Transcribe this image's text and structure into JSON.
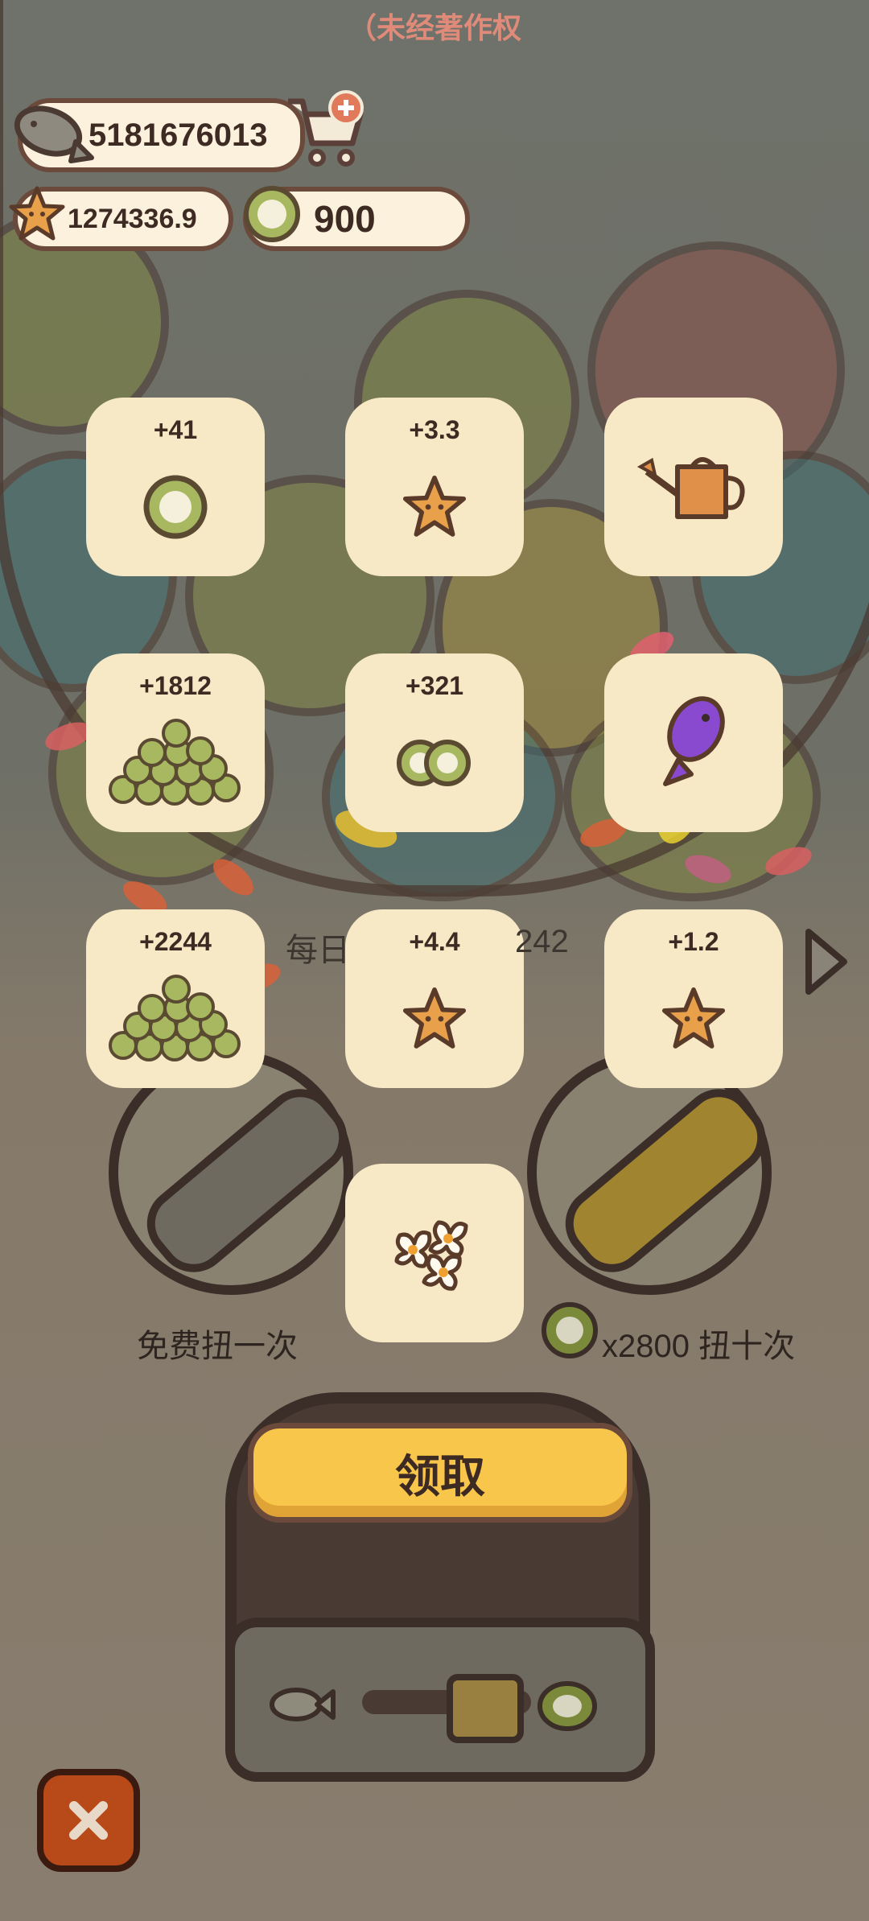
{
  "notice": "（未经著作权",
  "currency": {
    "fish": "5181676013",
    "stars": "1274336.9",
    "coins": "900"
  },
  "rewards": [
    {
      "amount": "+41",
      "icon": "coin-icon"
    },
    {
      "amount": "+3.3",
      "icon": "star-icon"
    },
    {
      "amount": "",
      "icon": "watering-can-icon"
    },
    {
      "amount": "+1812",
      "icon": "coin-pile-icon"
    },
    {
      "amount": "+321",
      "icon": "two-coins-icon"
    },
    {
      "amount": "",
      "icon": "purple-fish-icon"
    },
    {
      "amount": "+2244",
      "icon": "coin-pile-icon"
    },
    {
      "amount": "+4.4",
      "icon": "star-icon"
    },
    {
      "amount": "+1.2",
      "icon": "star-icon"
    },
    {
      "amount": "",
      "icon": "flowers-icon"
    }
  ],
  "daily_text_left": "每日",
  "daily_text_right": "242",
  "free_spin_label": "免费扭一次",
  "ten_spin_cost": "x2800 扭十次",
  "claim_label": "领取",
  "colors": {
    "accent": "#f8c64a",
    "card": "#f7e8c6",
    "outline": "#6b4a3c",
    "close": "#b84a1a"
  }
}
